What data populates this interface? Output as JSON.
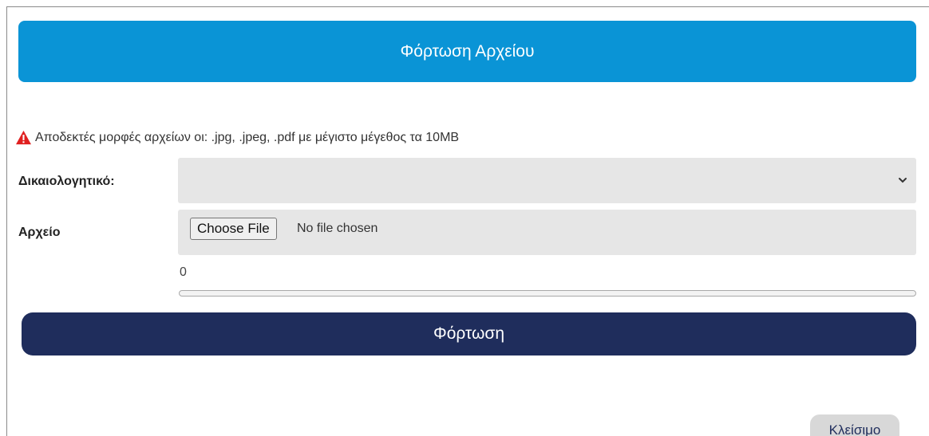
{
  "header": {
    "title": "Φόρτωση Αρχείου"
  },
  "notice": {
    "text": "Αποδεκτές μορφές αρχείων οι: .jpg, .jpeg, .pdf με μέγιστο μέγεθος τα 10MB",
    "icon": "warning-icon",
    "icon_color": "#e02020"
  },
  "document_field": {
    "label": "Δικαιολογητικό:",
    "selected_value": ""
  },
  "file_field": {
    "label": "Αρχείο",
    "button_label": "Choose File",
    "status": "No file chosen"
  },
  "progress": {
    "value_text": "0",
    "fraction": 0
  },
  "actions": {
    "upload_label": "Φόρτωση",
    "close_label": "Κλείσιμο"
  },
  "colors": {
    "header": "#0a94d6",
    "upload_button": "#1f2d5c",
    "close_button": "#d8d8d8"
  }
}
